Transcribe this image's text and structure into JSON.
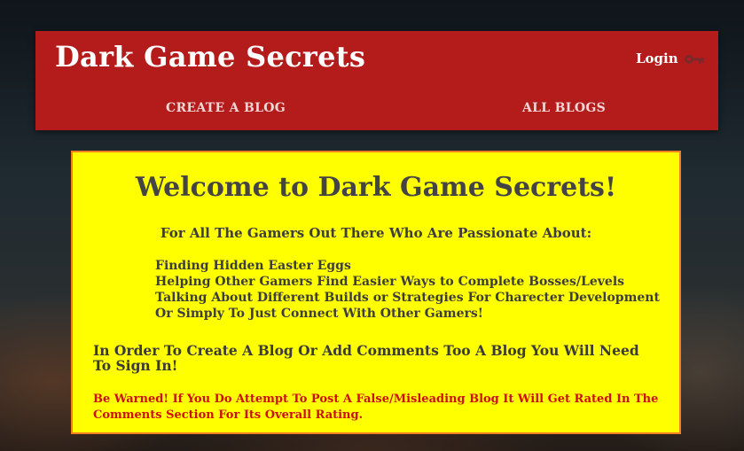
{
  "header": {
    "brand": "Dark Game Secrets",
    "login_label": "Login",
    "login_icon": "key-icon",
    "nav": [
      {
        "label": "CREATE A BLOG"
      },
      {
        "label": "ALL BLOGS"
      }
    ]
  },
  "main": {
    "welcome": "Welcome to Dark Game Secrets!",
    "subhead": "For All The Gamers Out There Who Are Passionate About:",
    "topics": [
      "Finding Hidden Easter Eggs",
      "Helping Other Gamers Find Easier Ways to Complete Bosses/Levels",
      "Talking About Different Builds or Strategies For Charecter Development",
      "Or Simply To Just Connect With Other Gamers!"
    ],
    "signin_notice": "In Order To Create A Blog Or Add Comments Too A Blog You Will Need To Sign In!",
    "warning": "Be Warned! If You Do Attempt To Post A False/Misleading Blog It Will Get Rated In The Comments Section For Its Overall Rating."
  },
  "colors": {
    "header_bg": "#b41b1b",
    "panel_bg": "#ffff00",
    "panel_border": "#f08020",
    "warning_text": "#cc1010"
  }
}
